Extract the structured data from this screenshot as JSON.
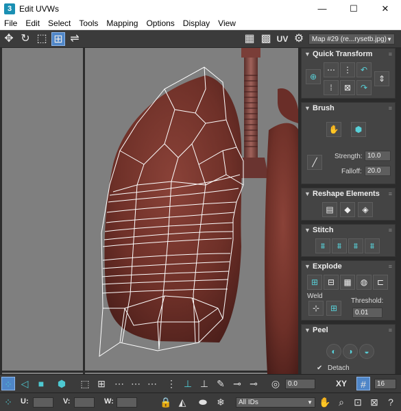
{
  "window": {
    "title": "Edit UVWs",
    "app_icon": "3",
    "minimize": "—",
    "maximize": "☐",
    "close": "✕"
  },
  "menu": [
    "File",
    "Edit",
    "Select",
    "Tools",
    "Mapping",
    "Options",
    "Display",
    "View"
  ],
  "toolbar": {
    "uv_label": "UV",
    "map_select": "Map #29 (re...rysetb.jpg)"
  },
  "panels": {
    "quick_transform": {
      "title": "Quick Transform"
    },
    "brush": {
      "title": "Brush",
      "strength_label": "Strength:",
      "strength_value": "10.0",
      "falloff_label": "Falloff:",
      "falloff_value": "20.0"
    },
    "reshape": {
      "title": "Reshape Elements"
    },
    "stitch": {
      "title": "Stitch"
    },
    "explode": {
      "title": "Explode",
      "weld_label": "Weld",
      "threshold_label": "Threshold:",
      "threshold_value": "0.01"
    },
    "peel": {
      "title": "Peel",
      "detach_label": "Detach",
      "detach_checked": true
    }
  },
  "bottom": {
    "rotate_value": "0.0",
    "xy_label": "XY",
    "grid_value": "16",
    "u_label": "U:",
    "v_label": "V:",
    "w_label": "W:",
    "ids_select": "All IDs"
  },
  "colors": {
    "accent": "#4ec9d2",
    "viewport": "#7f7f7f",
    "panel": "#444444",
    "selection": "#4f86c8"
  }
}
